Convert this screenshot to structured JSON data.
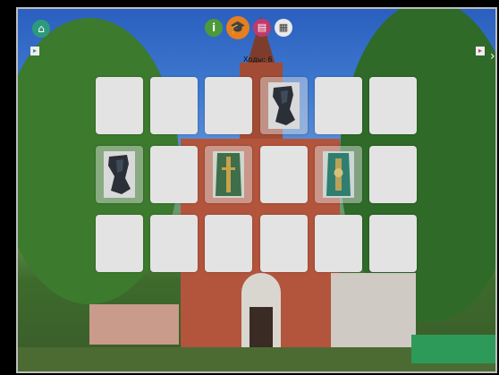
{
  "toolbar": {
    "icons": [
      "home-icon",
      "info-icon",
      "graduation-cap-icon",
      "book-icon",
      "calendar-icon"
    ],
    "active": "graduation-cap-icon",
    "colors": {
      "home": "#2e9a7c",
      "info": "#4c9a3a",
      "game": "#e67e22",
      "book": "#c0396b",
      "calendar": "#e9e9e9"
    }
  },
  "game": {
    "moves_label": "Ходы: 6",
    "rows": 3,
    "cols": 6,
    "cards": [
      {
        "state": "hidden"
      },
      {
        "state": "hidden"
      },
      {
        "state": "hidden"
      },
      {
        "state": "open",
        "image": "dark-vestment"
      },
      {
        "state": "hidden"
      },
      {
        "state": "hidden"
      },
      {
        "state": "open",
        "image": "dark-vestment"
      },
      {
        "state": "hidden"
      },
      {
        "state": "open",
        "image": "green-robe"
      },
      {
        "state": "hidden"
      },
      {
        "state": "open",
        "image": "teal-robe"
      },
      {
        "state": "hidden"
      },
      {
        "state": "hidden"
      },
      {
        "state": "hidden"
      },
      {
        "state": "hidden"
      },
      {
        "state": "hidden"
      },
      {
        "state": "hidden"
      },
      {
        "state": "hidden"
      }
    ]
  }
}
